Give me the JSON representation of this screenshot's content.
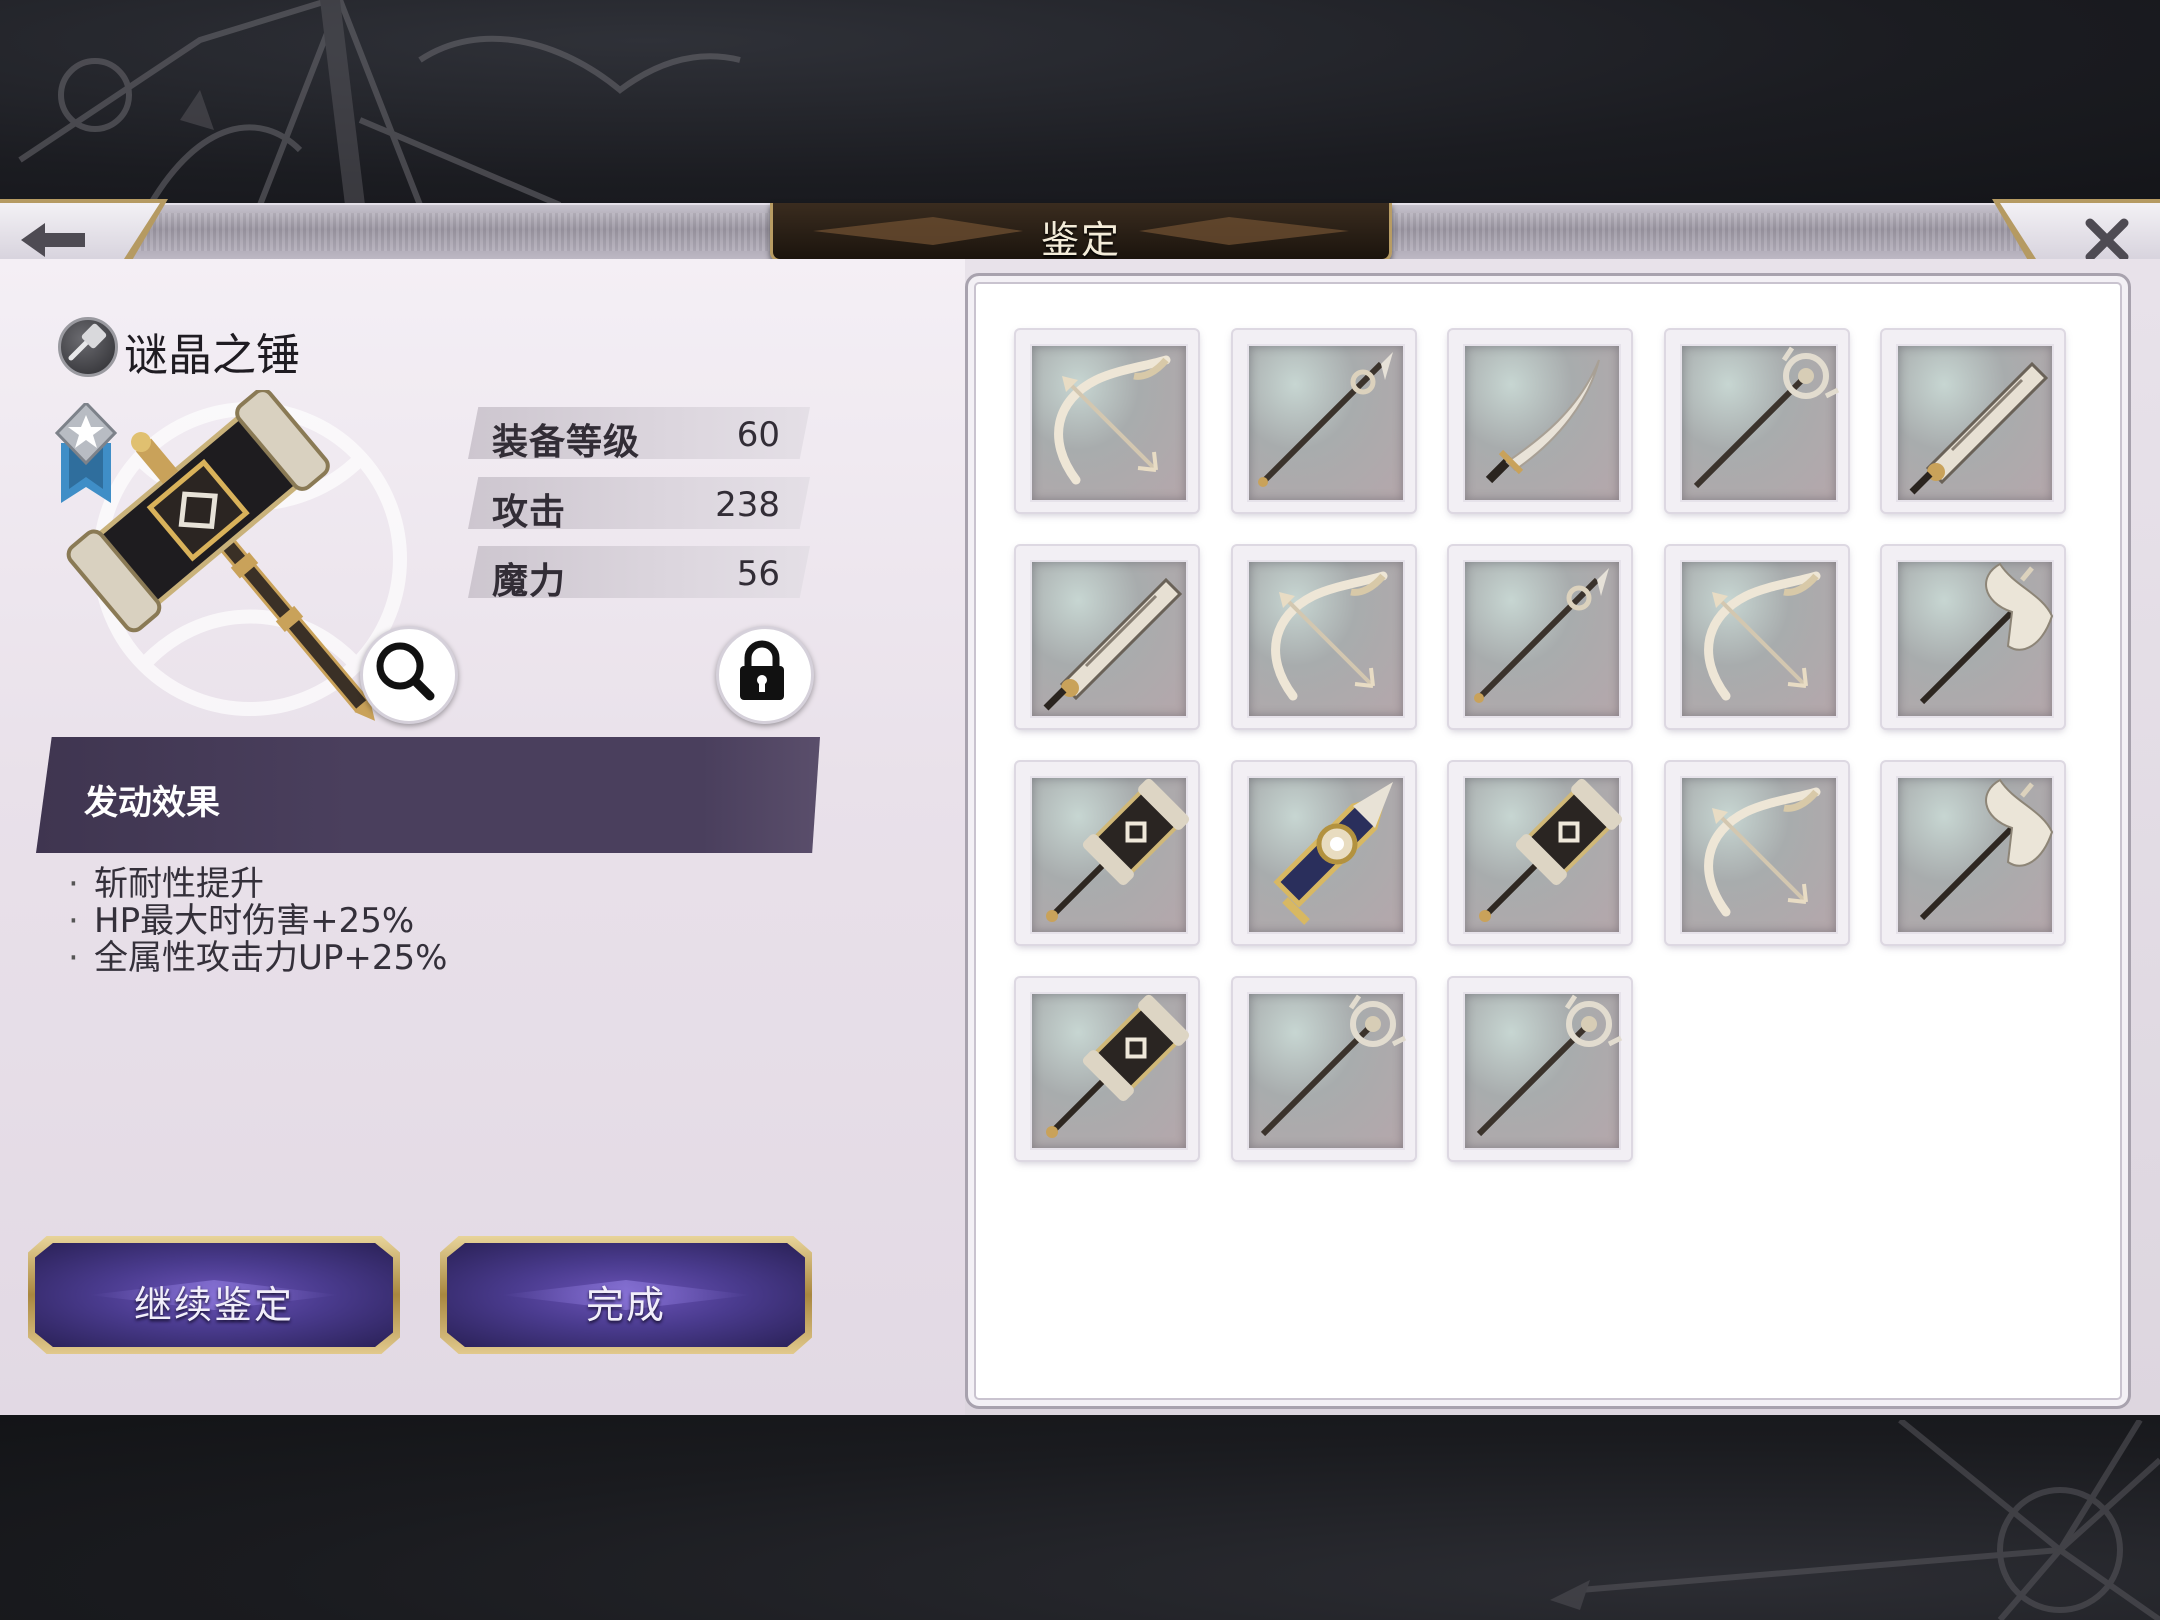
{
  "header": {
    "title": "鉴定"
  },
  "item": {
    "name": "谜晶之锤",
    "type_icon": "hammer-icon",
    "stats": [
      {
        "label": "装备等级",
        "value": "60"
      },
      {
        "label": "攻击",
        "value": "238"
      },
      {
        "label": "魔力",
        "value": "56"
      }
    ]
  },
  "effect": {
    "title": "发动效果",
    "lines": [
      "斩耐性提升",
      "HP最大时伤害+25%",
      "全属性攻击力UP+25%"
    ]
  },
  "buttons": {
    "continue_label": "继续鉴定",
    "done_label": "完成"
  },
  "grid": {
    "weapons": [
      "bow",
      "spear",
      "sword",
      "staff",
      "greatsword",
      "greatsword",
      "bow",
      "spear",
      "bow",
      "axe",
      "hammer",
      "knuckle",
      "hammer",
      "bow",
      "axe",
      "hammer",
      "staff",
      "staff"
    ]
  },
  "colors": {
    "accent_gold": "#b89c63",
    "button_purple": "#4a3b8e",
    "effect_bar": "#4a3f5d"
  }
}
